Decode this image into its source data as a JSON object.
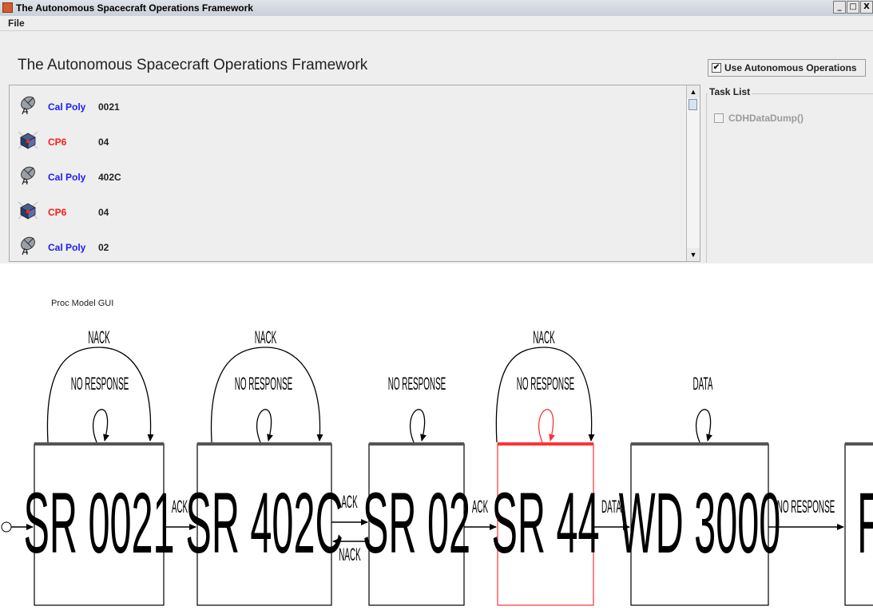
{
  "window": {
    "title": "The Autonomous Spacecraft Operations Framework",
    "buttons": [
      "_",
      "□",
      "X"
    ]
  },
  "menu": {
    "items": [
      "File"
    ]
  },
  "heading": "The Autonomous Spacecraft Operations Framework",
  "auto_ops": {
    "label": "Use Autonomous Operations",
    "checked": true
  },
  "list": [
    {
      "icon": "ground-station-icon",
      "name": "Cal Poly",
      "name_color": "#1a1aff",
      "value": "0021"
    },
    {
      "icon": "cubesat-icon",
      "name": "CP6",
      "name_color": "#ff1a1a",
      "value": "04"
    },
    {
      "icon": "ground-station-icon",
      "name": "Cal Poly",
      "name_color": "#1a1aff",
      "value": "402C"
    },
    {
      "icon": "cubesat-icon",
      "name": "CP6",
      "name_color": "#ff1a1a",
      "value": "04"
    },
    {
      "icon": "ground-station-icon",
      "name": "Cal Poly",
      "name_color": "#1a1aff",
      "value": "02"
    }
  ],
  "task_list": {
    "title": "Task List",
    "items": [
      {
        "label": "CDHDataDump()",
        "checked": false,
        "enabled": false
      }
    ]
  },
  "proc_model": {
    "label": "Proc Model GUI",
    "states": [
      {
        "label": "SR 0021",
        "active": false
      },
      {
        "label": "SR 402C",
        "active": false
      },
      {
        "label": "SR 02",
        "active": false
      },
      {
        "label": "SR 44",
        "active": true
      },
      {
        "label": "WD 3000",
        "active": false
      },
      {
        "label": "F",
        "active": false
      }
    ],
    "self_loops": [
      {
        "outer": "NACK",
        "inner": "NO RESPONSE"
      },
      {
        "outer": "NACK",
        "inner": "NO RESPONSE"
      },
      {
        "inner": "NO RESPONSE"
      },
      {
        "outer": "NACK",
        "inner": "NO RESPONSE"
      },
      {
        "inner": "DATA"
      }
    ],
    "transitions": [
      "ACK",
      "ACK",
      "NACK",
      "ACK",
      "DATA",
      "NO RESPONSE"
    ],
    "active_color": "#ff3333"
  }
}
